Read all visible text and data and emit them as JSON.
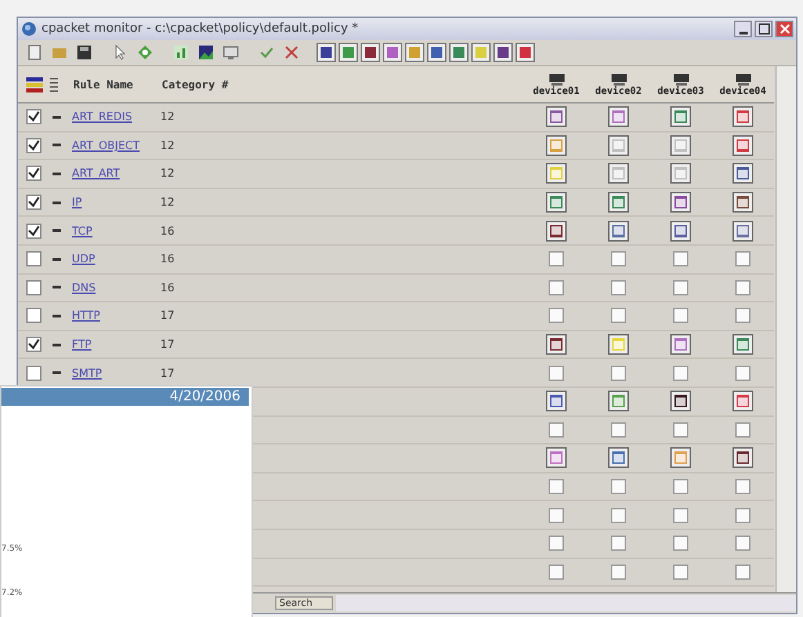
{
  "window": {
    "title": "cpacket monitor - c:\\cpacket\\policy\\default.policy *"
  },
  "toolbar": {
    "color_buttons": [
      {
        "color": "#3a3f9a"
      },
      {
        "color": "#3f9a4a"
      },
      {
        "color": "#8a2a3a"
      },
      {
        "color": "#b060c0"
      },
      {
        "color": "#d0a030"
      },
      {
        "color": "#4060b0"
      },
      {
        "color": "#3a8a5a"
      },
      {
        "color": "#d8d040"
      },
      {
        "color": "#6a3a8a"
      },
      {
        "color": "#d03040"
      }
    ]
  },
  "table": {
    "columns": [
      "Rule Name",
      "Category #"
    ],
    "devices": [
      "device01",
      "device02",
      "device03",
      "device04"
    ],
    "rows": [
      {
        "checked": true,
        "rule": "ART_REDIS",
        "category": "12",
        "devices": [
          {
            "checked": true,
            "color": "#8a5aa0"
          },
          {
            "checked": true,
            "color": "#b070c0"
          },
          {
            "checked": true,
            "color": "#3a8a5a"
          },
          {
            "checked": true,
            "color": "#d03a40"
          }
        ]
      },
      {
        "checked": true,
        "rule": "ART_OBJECT",
        "category": "12",
        "devices": [
          {
            "checked": true,
            "color": "#d8a040"
          },
          {
            "checked": true,
            "color": "#c0c0c0"
          },
          {
            "checked": true,
            "color": "#c0c0c0"
          },
          {
            "checked": true,
            "color": "#d03a40"
          }
        ]
      },
      {
        "checked": true,
        "rule": "ART_ART",
        "category": "12",
        "devices": [
          {
            "checked": true,
            "color": "#e0d040"
          },
          {
            "checked": true,
            "color": "#c0c0c0"
          },
          {
            "checked": true,
            "color": "#c0c0c0"
          },
          {
            "checked": true,
            "color": "#4a5a9a"
          }
        ]
      },
      {
        "checked": true,
        "rule": "IP",
        "category": "12",
        "devices": [
          {
            "checked": true,
            "color": "#3a8a5a"
          },
          {
            "checked": true,
            "color": "#3a8a5a"
          },
          {
            "checked": true,
            "color": "#8a4aa0"
          },
          {
            "checked": true,
            "color": "#7a4a3a"
          }
        ]
      },
      {
        "checked": true,
        "rule": "TCP",
        "category": "16",
        "devices": [
          {
            "checked": true,
            "color": "#7a2a30"
          },
          {
            "checked": true,
            "color": "#5a70a0"
          },
          {
            "checked": true,
            "color": "#5a60a0"
          },
          {
            "checked": true,
            "color": "#6a70a0"
          }
        ]
      },
      {
        "checked": false,
        "rule": "UDP",
        "category": "16",
        "devices": [
          {
            "checked": false
          },
          {
            "checked": false
          },
          {
            "checked": false
          },
          {
            "checked": false
          }
        ]
      },
      {
        "checked": false,
        "rule": "DNS",
        "category": "16",
        "devices": [
          {
            "checked": false
          },
          {
            "checked": false
          },
          {
            "checked": false
          },
          {
            "checked": false
          }
        ]
      },
      {
        "checked": false,
        "rule": "HTTP",
        "category": "17",
        "devices": [
          {
            "checked": false
          },
          {
            "checked": false
          },
          {
            "checked": false
          },
          {
            "checked": false
          }
        ]
      },
      {
        "checked": true,
        "rule": "FTP",
        "category": "17",
        "devices": [
          {
            "checked": true,
            "color": "#7a2a30"
          },
          {
            "checked": true,
            "color": "#e8d840"
          },
          {
            "checked": true,
            "color": "#b070c0"
          },
          {
            "checked": true,
            "color": "#3a8a5a"
          }
        ]
      },
      {
        "checked": false,
        "rule": "SMTP",
        "category": "17",
        "devices": [
          {
            "checked": false
          },
          {
            "checked": false
          },
          {
            "checked": false
          },
          {
            "checked": false
          }
        ]
      },
      {
        "devices": [
          {
            "checked": true,
            "color": "#4a5ab0"
          },
          {
            "checked": true,
            "color": "#5aa050"
          },
          {
            "checked": true,
            "color": "#3a1a20"
          },
          {
            "checked": true,
            "color": "#d83a4a"
          }
        ]
      },
      {
        "devices": [
          {
            "checked": false
          },
          {
            "checked": false
          },
          {
            "checked": false
          },
          {
            "checked": false
          }
        ]
      },
      {
        "devices": [
          {
            "checked": true,
            "color": "#c070c0"
          },
          {
            "checked": true,
            "color": "#4a70b0"
          },
          {
            "checked": true,
            "color": "#e0a050"
          },
          {
            "checked": true,
            "color": "#6a2a30"
          }
        ]
      },
      {
        "devices": [
          {
            "checked": false
          },
          {
            "checked": false
          },
          {
            "checked": false
          },
          {
            "checked": false
          }
        ]
      },
      {
        "devices": [
          {
            "checked": false
          },
          {
            "checked": false
          },
          {
            "checked": false
          },
          {
            "checked": false
          }
        ]
      },
      {
        "devices": [
          {
            "checked": false
          },
          {
            "checked": false
          },
          {
            "checked": false
          },
          {
            "checked": false
          }
        ]
      },
      {
        "devices": [
          {
            "checked": false
          },
          {
            "checked": false
          },
          {
            "checked": false
          },
          {
            "checked": false
          }
        ]
      }
    ]
  },
  "status_bar": {
    "search": "Search"
  },
  "report": {
    "date": "4/20/2006",
    "values": [
      "7.5%",
      "7.2%"
    ]
  }
}
